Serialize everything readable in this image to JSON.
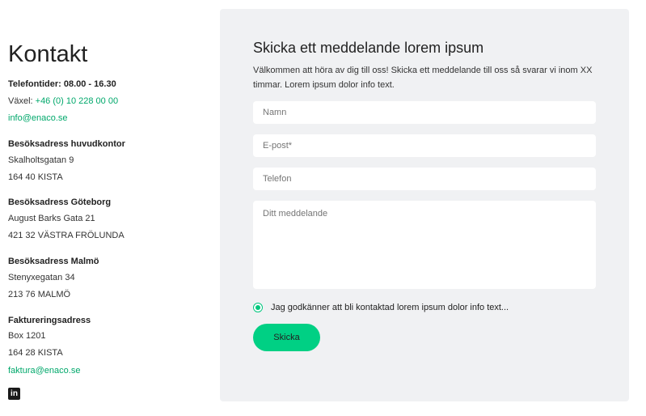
{
  "contact": {
    "title": "Kontakt",
    "hours": "Telefontider: 08.00 - 16.30",
    "switchboard_label": "Växel:",
    "switchboard_phone": "+46 (0) 10 228 00 00",
    "email": "info@enaco.se",
    "offices": [
      {
        "heading": "Besöksadress huvudkontor",
        "street": "Skalholtsgatan 9",
        "city": "164 40 KISTA"
      },
      {
        "heading": "Besöksadress Göteborg",
        "street": "August Barks Gata 21",
        "city": "421 32 VÄSTRA FRÖLUNDA"
      },
      {
        "heading": "Besöksadress Malmö",
        "street": "Stenyxegatan 34",
        "city": "213 76 MALMÖ"
      },
      {
        "heading": "Faktureringsadress",
        "street": "Box 1201",
        "city": "164 28 KISTA"
      }
    ],
    "billing_email": "faktura@enaco.se",
    "social_icon": "linkedin-icon",
    "social_glyph": "in"
  },
  "form": {
    "title": "Skicka ett meddelande lorem ipsum",
    "intro": "Välkommen att höra av dig till oss! Skicka ett meddelande till oss så svarar vi inom XX timmar. Lorem ipsum dolor info text.",
    "name_placeholder": "Namn",
    "email_placeholder": "E-post*",
    "phone_placeholder": "Telefon",
    "message_placeholder": "Ditt meddelande",
    "consent_label": "Jag godkänner att bli kontaktad lorem ipsum dolor info text...",
    "consent_checked": true,
    "submit_label": "Skicka"
  },
  "colors": {
    "accent": "#00d084",
    "link": "#00a86b",
    "panel": "#f0f1f3"
  }
}
